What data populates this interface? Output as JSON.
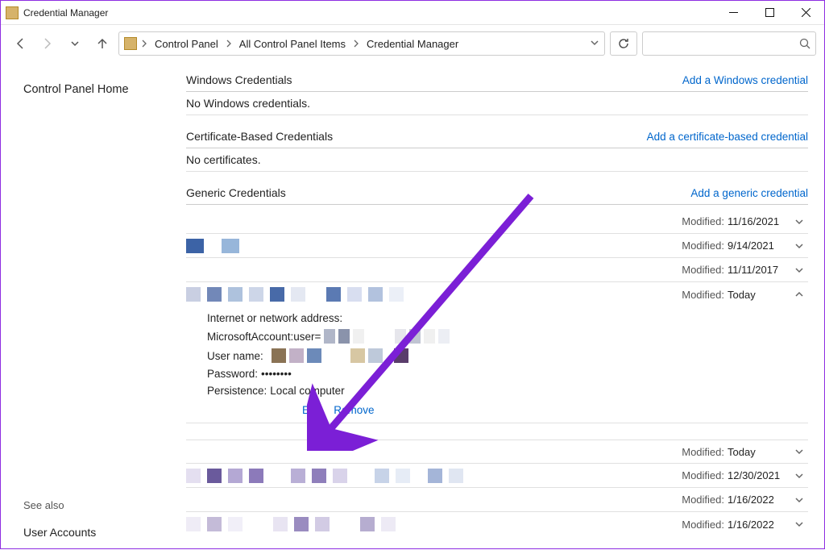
{
  "window": {
    "title": "Credential Manager"
  },
  "breadcrumbs": [
    "Control Panel",
    "All Control Panel Items",
    "Credential Manager"
  ],
  "sidebar": {
    "home": "Control Panel Home",
    "see_also": "See also",
    "user_accounts": "User Accounts"
  },
  "sections": {
    "windows": {
      "title": "Windows Credentials",
      "add": "Add a Windows credential",
      "empty": "No Windows credentials."
    },
    "cert": {
      "title": "Certificate-Based Credentials",
      "add": "Add a certificate-based credential",
      "empty": "No certificates."
    },
    "generic": {
      "title": "Generic Credentials",
      "add": "Add a generic credential"
    }
  },
  "modified_label": "Modified:",
  "generic_rows_top": [
    {
      "date": "11/16/2021"
    },
    {
      "date": "9/14/2021"
    },
    {
      "date": "11/11/2017"
    }
  ],
  "expanded": {
    "date": "Today",
    "addr_label": "Internet or network address:",
    "addr_value_prefix": "MicrosoftAccount:user=",
    "user_label": "User name:",
    "pass_label": "Password:",
    "pass_value": "••••••••",
    "persist_label": "Persistence:",
    "persist_value": "Local computer",
    "edit": "Edit",
    "remove": "Remove"
  },
  "generic_rows_bottom": [
    {
      "date": "Today"
    },
    {
      "date": "12/30/2021"
    },
    {
      "date": "1/16/2022"
    },
    {
      "date": "1/16/2022"
    }
  ]
}
